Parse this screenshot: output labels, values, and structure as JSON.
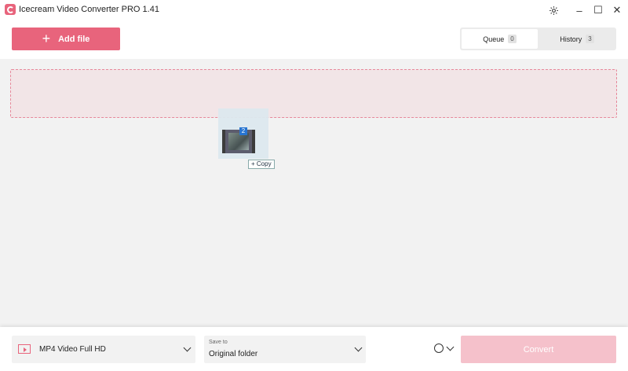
{
  "window": {
    "title": "Icecream Video Converter PRO 1.41"
  },
  "toolbar": {
    "add_file_label": "Add file",
    "tabs": [
      {
        "label": "Queue",
        "count": "0",
        "active": true
      },
      {
        "label": "History",
        "count": "3",
        "active": false
      }
    ]
  },
  "drag": {
    "item_count": "2",
    "copy_label": "+ Copy"
  },
  "bottom": {
    "format_value": "MP4 Video Full HD",
    "save_to_label": "Save to",
    "save_to_value": "Original folder",
    "convert_label": "Convert"
  },
  "colors": {
    "accent": "#e8647c",
    "accent_disabled": "#f5c1cb",
    "dropzone": "#f2e5e7"
  }
}
